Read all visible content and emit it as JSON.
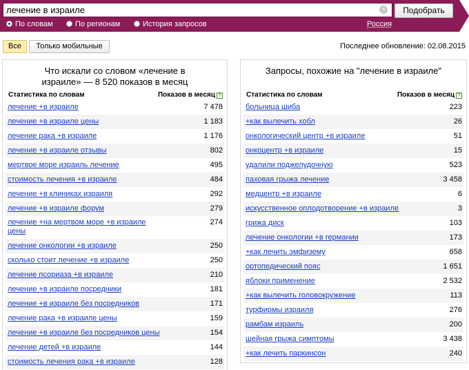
{
  "search": {
    "query": "лечение в израиле",
    "clear": "×",
    "submit_label": "Подобрать",
    "modes": [
      {
        "label": "По словам",
        "checked": true
      },
      {
        "label": "По регионам",
        "checked": false
      },
      {
        "label": "История запросов",
        "checked": false
      }
    ],
    "region": "Россия"
  },
  "filters": {
    "all_label": "Все",
    "mobile_label": "Только мобильные"
  },
  "updated": "Последнее обновление: 02.08.2015",
  "left_panel": {
    "title": "Что искали со словом «лечение в израиле» — 8 520 показов в месяц",
    "col_words": "Статистика по словам",
    "col_shows": "Показов в месяц",
    "help": "?",
    "rows": [
      {
        "phrase": "лечение +в израиле",
        "count": "7 478"
      },
      {
        "phrase": "лечение +в израиле цены",
        "count": "1 183"
      },
      {
        "phrase": "лечение рака +в израиле",
        "count": "1 176"
      },
      {
        "phrase": "лечение +в израиле отзывы",
        "count": "802"
      },
      {
        "phrase": "мертвое море израиль лечение",
        "count": "495"
      },
      {
        "phrase": "стоимость лечения +в израиле",
        "count": "484"
      },
      {
        "phrase": "лечение +в клиниках израиля",
        "count": "292"
      },
      {
        "phrase": "лечение +в израиле форум",
        "count": "279"
      },
      {
        "phrase": "лечение +на мертвом море +в израиле цены",
        "count": "274"
      },
      {
        "phrase": "лечение онкологии +в израиле",
        "count": "250"
      },
      {
        "phrase": "сколько стоит лечение +в израиле",
        "count": "250"
      },
      {
        "phrase": "лечение псориаза +в израиле",
        "count": "210"
      },
      {
        "phrase": "лечение +в израиле посредники",
        "count": "181"
      },
      {
        "phrase": "лечение +в израиле без посредников",
        "count": "171"
      },
      {
        "phrase": "лечение рака +в израиле цены",
        "count": "159"
      },
      {
        "phrase": "лечение +в израиле без посредников цены",
        "count": "154"
      },
      {
        "phrase": "лечение детей +в израиле",
        "count": "144"
      },
      {
        "phrase": "стоимость лечения рака +в израиле",
        "count": "128"
      }
    ]
  },
  "right_panel": {
    "title": "Запросы, похожие на \"лечение в израиле\"",
    "col_words": "Статистика по словам",
    "col_shows": "Показов в месяц",
    "help": "?",
    "rows": [
      {
        "phrase": "больница шиба",
        "count": "223"
      },
      {
        "phrase": "+как вылечить хобл",
        "count": "26"
      },
      {
        "phrase": "онкологический центр +в израиле",
        "count": "51"
      },
      {
        "phrase": "онкоцентр +в израиле",
        "count": "15"
      },
      {
        "phrase": "удалили поджелудочную",
        "count": "523"
      },
      {
        "phrase": "паховая грыжа лечение",
        "count": "3 458"
      },
      {
        "phrase": "медцентр +в израиле",
        "count": "6"
      },
      {
        "phrase": "искусственное оплодотворение +в израиле",
        "count": "3"
      },
      {
        "phrase": "грижа диск",
        "count": "103"
      },
      {
        "phrase": "лечение онкологии +в германии",
        "count": "173"
      },
      {
        "phrase": "+как лечить эмфизему",
        "count": "658"
      },
      {
        "phrase": "ортопедический пояс",
        "count": "1 651"
      },
      {
        "phrase": "яблоки применение",
        "count": "2 532"
      },
      {
        "phrase": "+как вылечить головокружение",
        "count": "113"
      },
      {
        "phrase": "турфирмы израиля",
        "count": "276"
      },
      {
        "phrase": "рамбам израиль",
        "count": "200"
      },
      {
        "phrase": "шейная грыжа симптомы",
        "count": "3 438"
      },
      {
        "phrase": "+как лечить паркинсон",
        "count": "240"
      }
    ]
  }
}
